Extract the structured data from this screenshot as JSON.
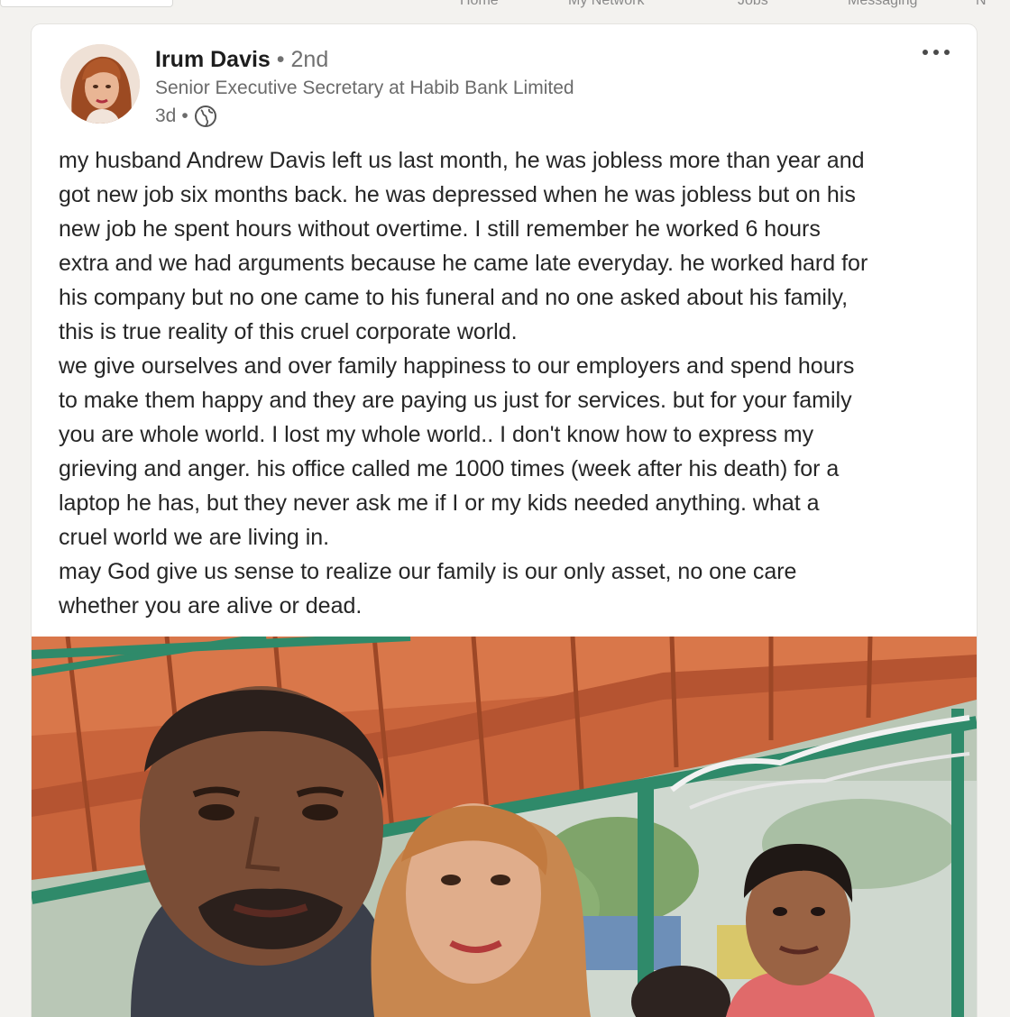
{
  "nav": {
    "items": [
      "Home",
      "My Network",
      "Jobs",
      "Messaging",
      "N"
    ]
  },
  "post": {
    "author": {
      "name": "Irum Davis",
      "separator": "•",
      "degree": "2nd",
      "headline": "Senior Executive Secretary at Habib Bank Limited",
      "time": "3d",
      "visibility_separator": "•",
      "visibility_icon": "globe-icon"
    },
    "menu_icon": "more-horizontal-icon",
    "text_lines": [
      "my husband Andrew Davis left us last month, he was jobless more than year and",
      "got new job six months back. he was depressed when he was jobless but on his",
      "new job he spent hours without overtime. I still remember he worked 6 hours",
      "extra and we had arguments because he came late everyday. he worked hard for",
      "his company but no one came to his funeral and no one asked about his family,",
      "this is true reality of this cruel corporate world.",
      "we give ourselves and over family happiness to our employers and spend hours",
      "to make them happy and they are paying us just for services. but for your family",
      "you are whole world. I lost my whole world.. I don't know how to express my",
      "grieving and anger. his office called me 1000 times (week after his death) for a",
      "laptop he has, but they never ask me if I or my kids needed anything. what a",
      "cruel world we are living in.",
      "may God give us sense to realize our family is our only asset, no one care",
      "whether you are alive or dead."
    ]
  },
  "colors": {
    "page_bg": "#f3f2ef",
    "card_bg": "#ffffff",
    "text_primary": "#262626",
    "text_secondary": "#6b6b6b",
    "roof_orange": "#c9643b",
    "beam_green": "#2f8a6a"
  }
}
